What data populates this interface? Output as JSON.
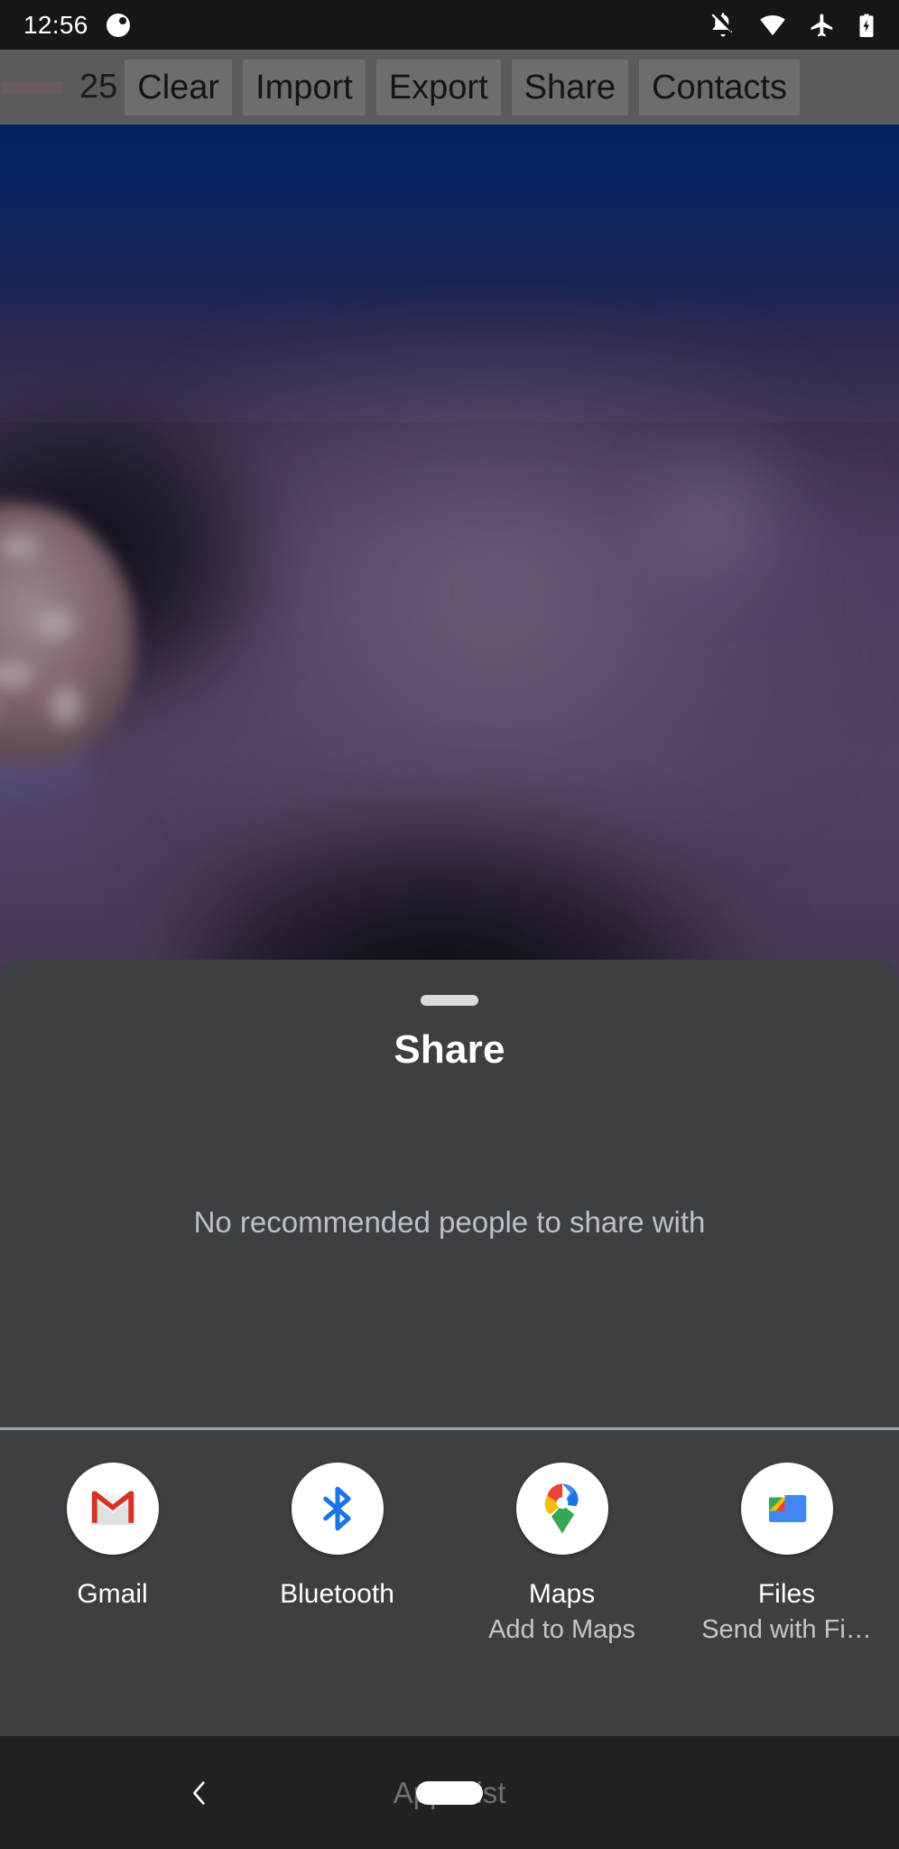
{
  "status_bar": {
    "time": "12:56",
    "icons": [
      "notification-dot-icon",
      "notifications-off-icon",
      "wifi-icon",
      "airplane-mode-icon",
      "battery-charging-icon"
    ]
  },
  "toolbar": {
    "count": "25",
    "buttons": [
      {
        "label": "Clear",
        "name": "clear-button"
      },
      {
        "label": "Import",
        "name": "import-button"
      },
      {
        "label": "Export",
        "name": "export-button"
      },
      {
        "label": "Share",
        "name": "share-button"
      },
      {
        "label": "Contacts",
        "name": "contacts-button"
      }
    ]
  },
  "wallpaper": {
    "description": "blurred underwater aquarium photo, deep blue top, purple haze, jellyfish at left edge",
    "colors": {
      "top_blue": "#0a2a70",
      "mid_purple": "#5a4a6b",
      "shadow": "#0a0812"
    }
  },
  "share_sheet": {
    "title": "Share",
    "empty_message": "No recommended people to share with",
    "background": "#3c4043",
    "apps": [
      {
        "label": "Gmail",
        "subtitle": "",
        "icon": "gmail-icon"
      },
      {
        "label": "Bluetooth",
        "subtitle": "",
        "icon": "bluetooth-icon"
      },
      {
        "label": "Maps",
        "subtitle": "Add to Maps",
        "icon": "google-maps-icon"
      },
      {
        "label": "Files",
        "subtitle": "Send with Fi…",
        "icon": "google-files-icon"
      }
    ]
  },
  "nav_bar": {
    "apps_list_label": "Apps list",
    "back_icon": "chevron-left-icon",
    "home_indicator": "home-pill-icon"
  }
}
